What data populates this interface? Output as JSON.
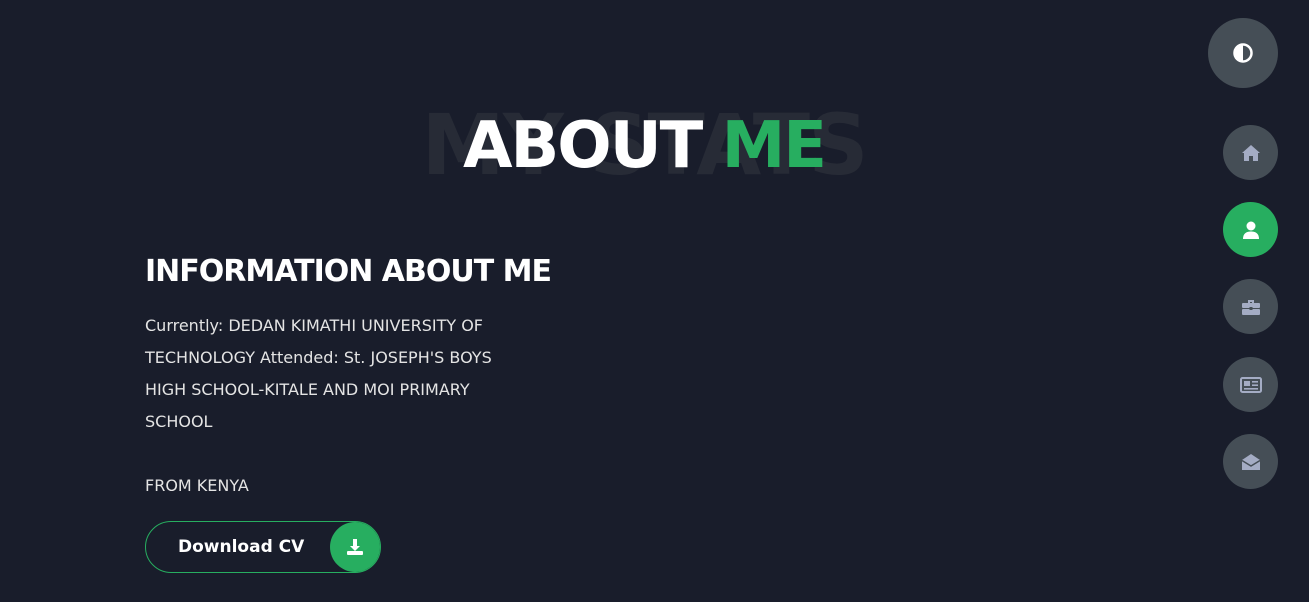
{
  "section": {
    "background_word": "MY STATS",
    "title_main": "ABOUT",
    "title_accent": "ME"
  },
  "info": {
    "heading": "INFORMATION ABOUT ME",
    "description": "Currently: DEDAN KIMATHI UNIVERSITY OF TECHNOLOGY Attended: St. JOSEPH'S BOYS HIGH SCHOOL-KITALE AND MOI PRIMARY SCHOOL",
    "origin": "FROM KENYA"
  },
  "download_button": {
    "label": "Download CV",
    "icon": "download-icon"
  },
  "controls": {
    "theme_toggle_icon": "contrast-icon",
    "nav": [
      {
        "icon": "home-icon",
        "active": false
      },
      {
        "icon": "user-icon",
        "active": true
      },
      {
        "icon": "briefcase-icon",
        "active": false
      },
      {
        "icon": "newspaper-icon",
        "active": false
      },
      {
        "icon": "envelope-open-icon",
        "active": false
      }
    ]
  },
  "colors": {
    "background": "#191d2b",
    "accent": "#27ae60",
    "control_bg": "#454e56",
    "icon_color": "#a4acc4",
    "ghost_text": "#272b36"
  }
}
